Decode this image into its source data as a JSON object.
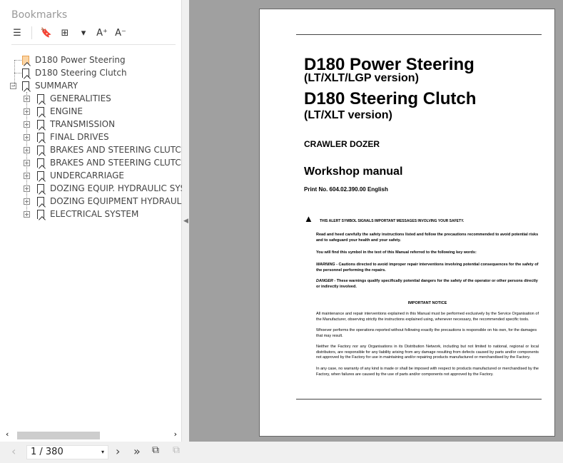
{
  "sidebar": {
    "title": "Bookmarks",
    "tools": [
      "expand-all",
      "delete-bookmark",
      "add-bookmark",
      "bookmark-options",
      "increase-font",
      "decrease-font"
    ],
    "items": [
      {
        "label": "D180 Power Steering",
        "level": 0,
        "selected": true
      },
      {
        "label": "D180 Steering Clutch",
        "level": 0
      },
      {
        "label": "SUMMARY",
        "level": 0,
        "expanded": true
      },
      {
        "label": "GENERALITIES",
        "level": 1
      },
      {
        "label": " ENGINE",
        "level": 1
      },
      {
        "label": "TRANSMISSION",
        "level": 1
      },
      {
        "label": "FINAL DRIVES",
        "level": 1
      },
      {
        "label": "BRAKES AND STEERING CLUTCHES",
        "level": 1
      },
      {
        "label": "BRAKES AND STEERING CLUTCHES",
        "level": 1
      },
      {
        "label": "UNDERCARRIAGE",
        "level": 1
      },
      {
        "label": "DOZING EQUIP. HYDRAULIC SYSTEM",
        "level": 1
      },
      {
        "label": "DOZING EQUIPMENT HYDRAULIC",
        "level": 1
      },
      {
        "label": "ELECTRICAL SYSTEM",
        "level": 1
      }
    ]
  },
  "doc": {
    "title1": "D180 Power Steering",
    "sub1": "(LT/XLT/LGP version)",
    "title2": "D180 Steering Clutch",
    "sub2": "(LT/XLT version)",
    "type": "CRAWLER DOZER",
    "manual": "Workshop manual",
    "print": "Print No. 604.02.390.00 English",
    "alert": "THIS ALERT SYMBOL SIGNALS IMPORTANT MESSAGES INVOLVING YOUR SAFETY.",
    "p1": "Read and heed carefully the safety instructions listed and follow the precautions recommended to avoid potential risks and to safeguard your health and your safety.",
    "p2": "You will find this symbol in the text of this Manual referred to the following key words:",
    "warning_kw": "WARNING",
    "warning": " - Cautions directed to avoid improper repair interventions involving potential consequences for the  safety of the personnel performing the repairs.",
    "danger_kw": "DANGER",
    "danger": " - These warnings qualify specifically potential dangers for the safety of the operator or other persons directly or indirectly involved.",
    "notice_title": "IMPORTANT NOTICE",
    "n1": "All maintenance and repair interventions explained in this Manual must be performed exclusively by the Service Organisation of the Manufacturer, observing strictly the instructions explained using, whenever necessary, the recommended specific tools.",
    "n2": "Whoever performs the operations reported without following exactly the precautions is responsible on his own, for the damages that may result.",
    "n3": "Neither the Factory nor any Organisations in its Distribution Network, including but not limited to national, regional or local distributors, are responsible for any liability arising from any damage resulting from defects caused by parts and/or components not approved by the Factory for use in maintaining and/or repairing products manufactured or merchandised by the Factory.",
    "n4": "In any case, no warranty of any kind is made or shall be imposed with respect to products manufactured or merchandised by the Factory, when failures are caused by the use of parts and/or components not approved by the Factory."
  },
  "nav": {
    "page": "1 / 380"
  }
}
